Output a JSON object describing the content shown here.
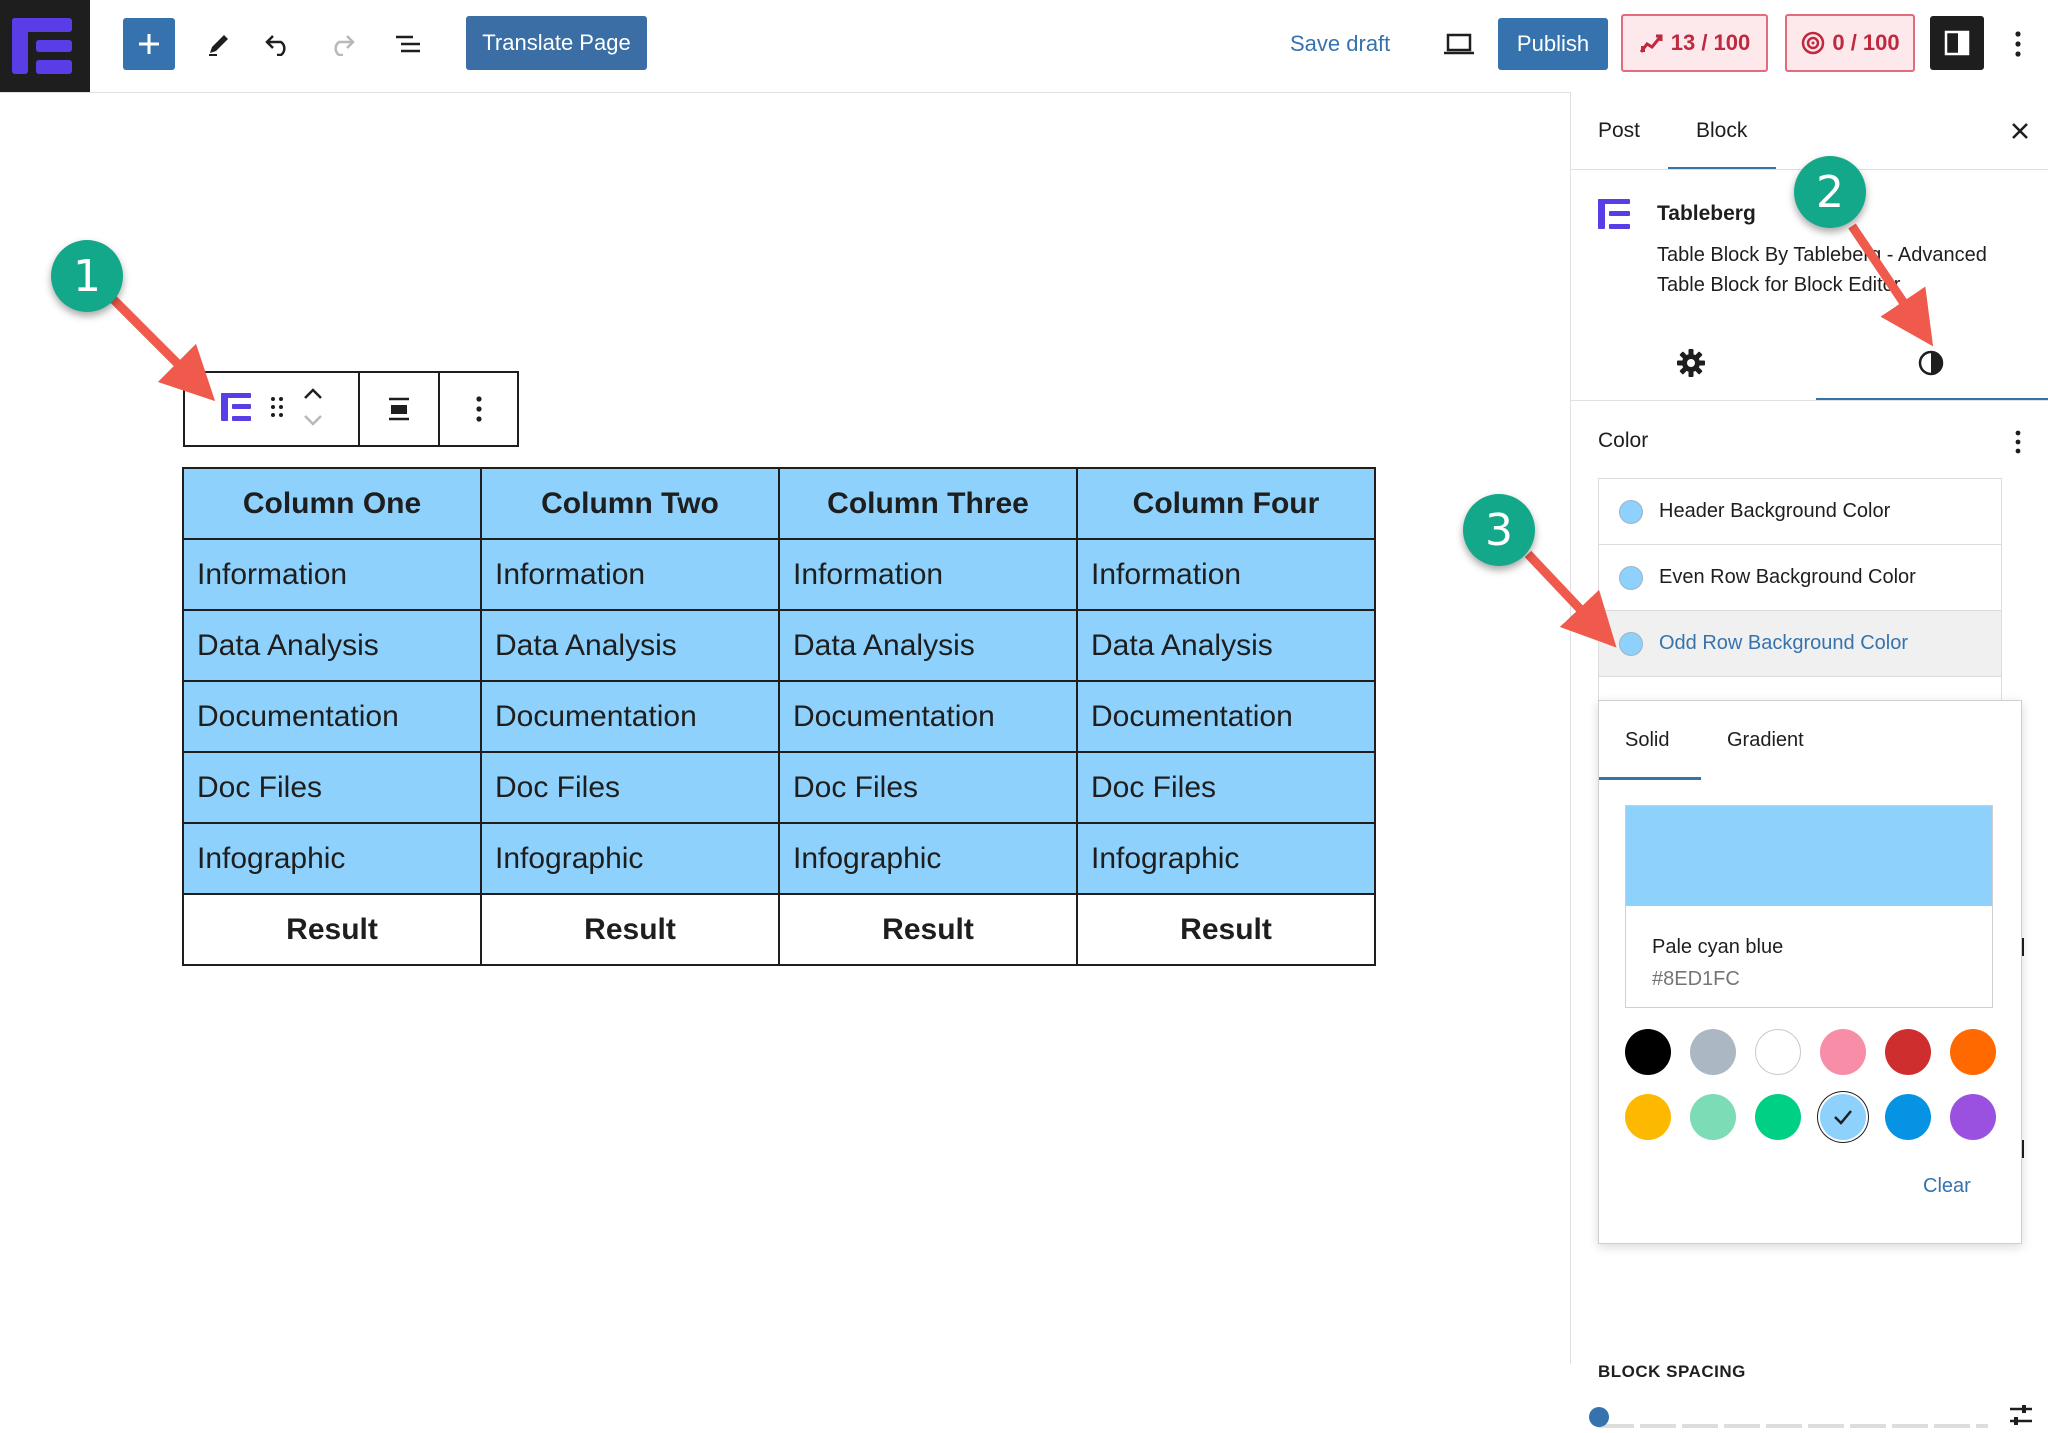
{
  "topbar": {
    "logo_icon": "tableberg-logo-icon",
    "add_icon": "plus-icon",
    "edit_icon": "pencil-icon",
    "undo_icon": "undo-icon",
    "redo_icon": "redo-icon",
    "list_view_icon": "list-view-icon",
    "translate_label": "Translate Page",
    "save_draft_label": "Save draft",
    "preview_icon": "laptop-icon",
    "publish_label": "Publish",
    "score_a_label": "13 / 100",
    "score_b_label": "0 / 100",
    "sidebar_toggle_icon": "sidebar-icon",
    "more_icon": "vertical-ellipsis-icon"
  },
  "block_toolbar": {
    "block_icon": "tableberg-block-icon",
    "drag_icon": "drag-handle-icon",
    "move_icon": "chevron-up-down-icon",
    "align_icon": "align-center-icon",
    "more_icon": "vertical-ellipsis-icon"
  },
  "table": {
    "headers": [
      "Column One",
      "Column Two",
      "Column Three",
      "Column Four"
    ],
    "rows": [
      [
        "Information",
        "Information",
        "Information",
        "Information"
      ],
      [
        "Data Analysis",
        "Data Analysis",
        "Data Analysis",
        "Data Analysis"
      ],
      [
        "Documentation",
        "Documentation",
        "Documentation",
        "Documentation"
      ],
      [
        "Doc Files",
        "Doc Files",
        "Doc Files",
        "Doc Files"
      ],
      [
        "Infographic",
        "Infographic",
        "Infographic",
        "Infographic"
      ]
    ],
    "footer": [
      "Result",
      "Result",
      "Result",
      "Result"
    ],
    "cell_color": "#8ED1FC"
  },
  "callouts": [
    "1",
    "2",
    "3"
  ],
  "callout_color": "#14a88a",
  "arrow_color": "#ef5a4c",
  "sidebar": {
    "tabs": [
      "Post",
      "Block"
    ],
    "close_icon": "close-icon",
    "block_title": "Tableberg",
    "block_description": "Table Block By Tableberg - Advanced Table Block for Block Editor",
    "settings_icon": "gear-icon",
    "styles_icon": "half-circle-contrast-icon",
    "color_heading": "Color",
    "color_items": [
      "Header Background Color",
      "Even Row Background Color",
      "Odd Row Background Color"
    ],
    "block_spacing_label": "BLOCK SPACING",
    "spacing_custom_icon": "sliders-icon"
  },
  "color_popover": {
    "tabs": [
      "Solid",
      "Gradient"
    ],
    "selected_name": "Pale cyan blue",
    "selected_hex": "#8ED1FC",
    "palette": [
      "#000000",
      "#abb8c3",
      "#ffffff",
      "#f78da7",
      "#cf2e2e",
      "#ff6900",
      "#fcb900",
      "#7bdcb5",
      "#00d084",
      "#8ed1fc",
      "#0693e3",
      "#9b51e0"
    ],
    "selected_index": 9,
    "clear_label": "Clear"
  },
  "accent": "#3673ae"
}
